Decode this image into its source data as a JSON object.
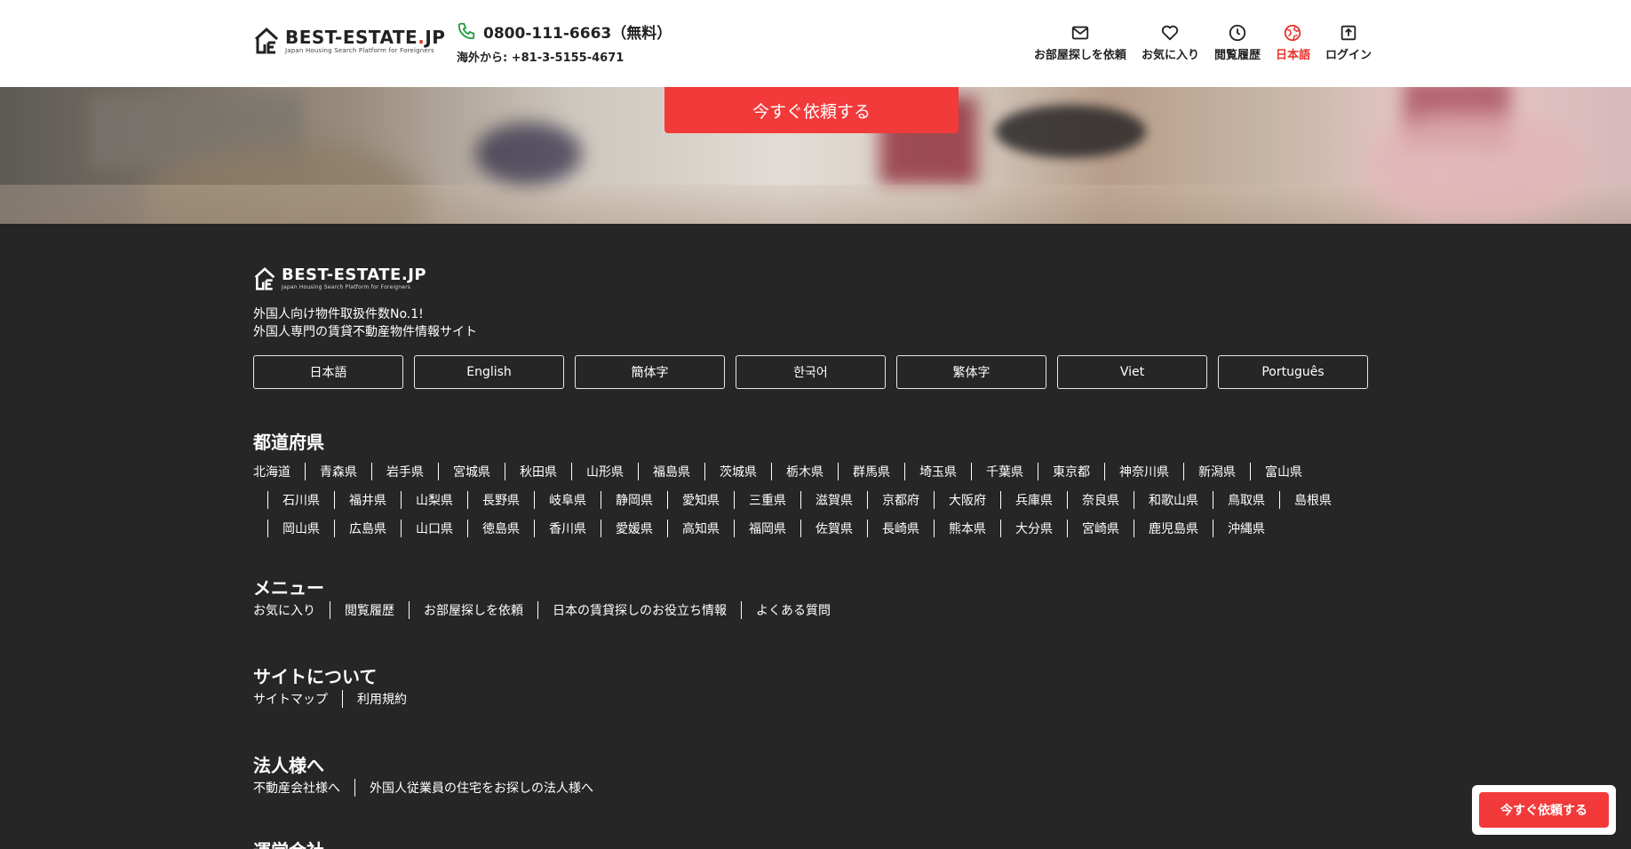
{
  "header": {
    "logo": {
      "title_main": "BEST-ESTATE",
      "title_dot": ".",
      "title_tld": "JP",
      "subtitle": "Japan Housing Search Platform for Foreigners"
    },
    "phone": "0800-111-6663（無料）",
    "phone_overseas": "海外から: +81-3-5155-4671",
    "nav": [
      {
        "label": "お部屋探しを依頼",
        "icon": "mail-icon"
      },
      {
        "label": "お気に入り",
        "icon": "heart-icon"
      },
      {
        "label": "閲覧履歴",
        "icon": "clock-icon"
      },
      {
        "label": "日本語",
        "icon": "globe-icon",
        "active": true
      },
      {
        "label": "ログイン",
        "icon": "login-icon"
      }
    ]
  },
  "hero": {
    "cta_label": "今すぐ依頼する"
  },
  "footer": {
    "logo": {
      "title_main": "BEST-ESTATE",
      "title_dot": ".",
      "title_tld": "JP",
      "subtitle": "Japan Housing Search Platform for Foreigners"
    },
    "tagline_1": "外国人向け物件取扱件数No.1!",
    "tagline_2": "外国人専門の賃貸不動産物件情報サイト",
    "languages": [
      "日本語",
      "English",
      "簡体字",
      "한국어",
      "繁体字",
      "Viet",
      "Português"
    ],
    "prefectures_title": "都道府県",
    "prefectures": [
      [
        "北海道",
        "青森県",
        "岩手県",
        "宮城県",
        "秋田県",
        "山形県",
        "福島県",
        "茨城県",
        "栃木県",
        "群馬県",
        "埼玉県",
        "千葉県",
        "東京都",
        "神奈川県",
        "新潟県",
        "富山県"
      ],
      [
        "石川県",
        "福井県",
        "山梨県",
        "長野県",
        "岐阜県",
        "静岡県",
        "愛知県",
        "三重県",
        "滋賀県",
        "京都府",
        "大阪府",
        "兵庫県",
        "奈良県",
        "和歌山県",
        "鳥取県",
        "島根県"
      ],
      [
        "岡山県",
        "広島県",
        "山口県",
        "徳島県",
        "香川県",
        "愛媛県",
        "高知県",
        "福岡県",
        "佐賀県",
        "長崎県",
        "熊本県",
        "大分県",
        "宮崎県",
        "鹿児島県",
        "沖縄県"
      ]
    ],
    "menu_title": "メニュー",
    "menu": [
      "お気に入り",
      "閲覧履歴",
      "お部屋探しを依頼",
      "日本の賃貸探しのお役立ち情報",
      "よくある質問"
    ],
    "about_title": "サイトについて",
    "about": [
      "サイトマップ",
      "利用規約"
    ],
    "corporate_title": "法人様へ",
    "corporate": [
      "不動産会社様へ",
      "外国人従業員の住宅をお探しの法人様へ"
    ],
    "company_title": "運営会社"
  },
  "float_cta": {
    "label": "今すぐ依頼する"
  },
  "colors": {
    "accent": "#f23a3a",
    "footer_bg": "#262626"
  }
}
